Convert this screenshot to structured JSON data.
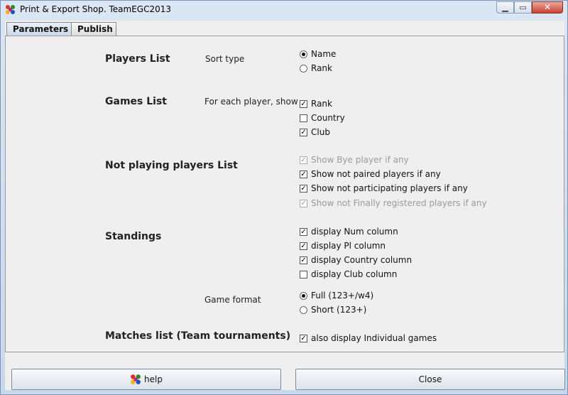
{
  "window": {
    "title": "Print & Export Shop. TeamEGC2013"
  },
  "tabs": [
    {
      "label": "Parameters"
    },
    {
      "label": "Publish"
    }
  ],
  "players_list": {
    "title": "Players List",
    "sort_label": "Sort type",
    "options": [
      {
        "label": "Name",
        "selected": true
      },
      {
        "label": "Rank",
        "selected": false
      }
    ]
  },
  "games_list": {
    "title": "Games List",
    "show_label": "For each player, show",
    "options": [
      {
        "label": "Rank",
        "checked": true
      },
      {
        "label": "Country",
        "checked": false
      },
      {
        "label": "Club",
        "checked": true
      }
    ]
  },
  "not_playing": {
    "title": "Not playing players List",
    "options": [
      {
        "label": "Show Bye player if any",
        "checked": true,
        "enabled": false
      },
      {
        "label": "Show not paired players if any",
        "checked": true,
        "enabled": true
      },
      {
        "label": "Show not participating players if any",
        "checked": true,
        "enabled": true
      },
      {
        "label": "Show not Finally registered players if any",
        "checked": true,
        "enabled": false
      }
    ]
  },
  "standings": {
    "title": "Standings",
    "options": [
      {
        "label": "display Num column",
        "checked": true
      },
      {
        "label": "display Pl column",
        "checked": true
      },
      {
        "label": "display Country column",
        "checked": true
      },
      {
        "label": "display Club column",
        "checked": false
      }
    ],
    "game_format_label": "Game format",
    "game_format_options": [
      {
        "label": "Full (123+/w4)",
        "selected": true
      },
      {
        "label": "Short (123+)",
        "selected": false
      }
    ]
  },
  "matches_list": {
    "title": "Matches list (Team tournaments)",
    "option": {
      "label": "also display Individual games",
      "checked": true
    }
  },
  "buttons": {
    "help": "help",
    "close": "Close"
  },
  "icons": {
    "app": "egc-logo-icon",
    "help": "egc-logo-icon"
  }
}
